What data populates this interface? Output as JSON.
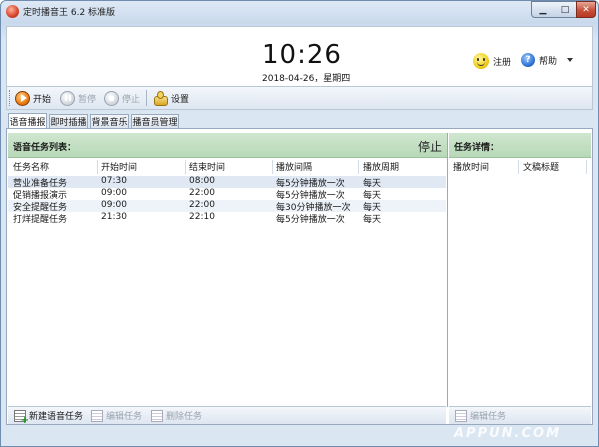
{
  "window": {
    "title": "定时播音王 6.2 标准版"
  },
  "header": {
    "clock": "10:26",
    "date": "2018-04-26，星期四",
    "register": "注册",
    "help": "帮助"
  },
  "toolbar": {
    "start": "开始",
    "pause": "暂停",
    "stop": "停止",
    "settings": "设置"
  },
  "tabs": [
    "语音播报",
    "即时插播",
    "背景音乐",
    "播音员管理"
  ],
  "task_list": {
    "title": "语音任务列表：",
    "status": "停止",
    "columns": [
      "任务名称",
      "开始时间",
      "结束时间",
      "播放间隔",
      "播放周期"
    ],
    "rows": [
      [
        "营业准备任务",
        "07:30",
        "08:00",
        "每5分钟播放一次",
        "每天"
      ],
      [
        "促销播报演示",
        "09:00",
        "22:00",
        "每5分钟播放一次",
        "每天"
      ],
      [
        "安全提醒任务",
        "09:00",
        "22:00",
        "每30分钟播放一次",
        "每天"
      ],
      [
        "打烊提醒任务",
        "21:30",
        "22:10",
        "每5分钟播放一次",
        "每天"
      ]
    ]
  },
  "details": {
    "title": "任务详情：",
    "columns": [
      "播放时间",
      "文稿标题"
    ]
  },
  "bottom": {
    "new_task": "新建语音任务",
    "edit_task": "编辑任务",
    "delete_task": "删除任务",
    "edit_task_right": "编辑任务"
  },
  "watermark": "APPUN.COM"
}
